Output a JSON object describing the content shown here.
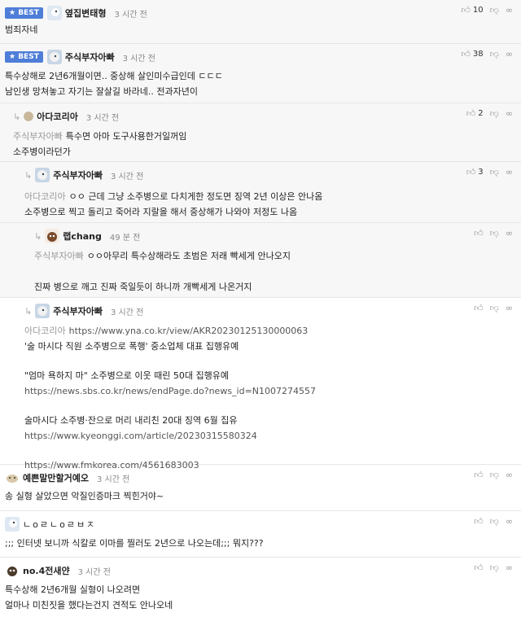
{
  "comments": [
    {
      "badge": "★ BEST",
      "nick": "옆집변태형",
      "time": "3 시간 전",
      "likes": "10",
      "lines": [
        "범죄자네"
      ]
    },
    {
      "badge": "★ BEST",
      "nick": "주식부자아빠",
      "time": "3 시간 전",
      "likes": "38",
      "lines": [
        "특수상해로 2년6개월이면.. 중상해 살인미수급인데 ㄷㄷㄷ",
        "남인생 망쳐놓고 자기는 잘살길 바라네.. 전과자년이"
      ]
    },
    {
      "nick": "아다코리아",
      "time": "3 시간 전",
      "likes": "2",
      "mention": "주식부자아빠",
      "lines": [
        "특수면 아마 도구사용한거일꺼임",
        "소주병이라던가"
      ]
    },
    {
      "nick": "주식부자아빠",
      "time": "3 시간 전",
      "likes": "3",
      "mention": "아다코리아",
      "lines": [
        "ㅇㅇ 근데 그냥 소주병으로 다치게한 정도면 징역 2년 이상은 안나옴",
        "소주병으로 찍고 돌리고 죽어라 지랄을 해서 중상해가 나와야 저정도 나옴"
      ]
    },
    {
      "nick": "랩chang",
      "time": "49 분 전",
      "mention": "주식부자아빠",
      "lines": [
        "ㅇㅇ아무리 특수상해라도 초범은 저래 빡세게 안나오지",
        "",
        "진짜 병으로 깨고 진짜 죽일듯이 하니까 개빡세게 나온거지"
      ]
    },
    {
      "nick": "주식부자아빠",
      "time": "3 시간 전",
      "mention": "아다코리아",
      "lines": [
        "https://www.yna.co.kr/view/AKR20230125130000063",
        "'술 마시다 직원 소주병으로 폭행' 중소업체 대표 집행유예",
        "",
        "\"엄마 욕하지 마\" 소주병으로 이웃 때린 50대 집행유예",
        "https://news.sbs.co.kr/news/endPage.do?news_id=N1007274557",
        "",
        "술마시다 소주병·잔으로 머리 내리친 20대 징역 6월 집유",
        "https://www.kyeonggi.com/article/20230315580324",
        "",
        "https://www.fmkorea.com/4561683003"
      ]
    },
    {
      "nick": "예쁜말만할거예오",
      "time": "3 시간 전",
      "lines": [
        "송 실형 살았으면 악질인증마크 찍힌거야~"
      ]
    },
    {
      "nick": "ㄴoㄹㄴoㄹㅂㅈ",
      "time": "",
      "lines": [
        ";;; 인터넷 보니까 식칼로 이마를 찔러도 2년으로 나오는데;;; 뭐지???"
      ]
    },
    {
      "nick": "no.4전새얀",
      "time": "3 시간 전",
      "lines": [
        "특수상해 2년6개월 실형이 나오려면",
        "얼마나 미친짓을 했다는건지 견적도 안나오네"
      ]
    }
  ],
  "icons": {
    "like": "thumbs-up-icon",
    "dislike": "thumbs-down-icon",
    "share": "link-icon",
    "reply": "reply-arrow-icon"
  }
}
